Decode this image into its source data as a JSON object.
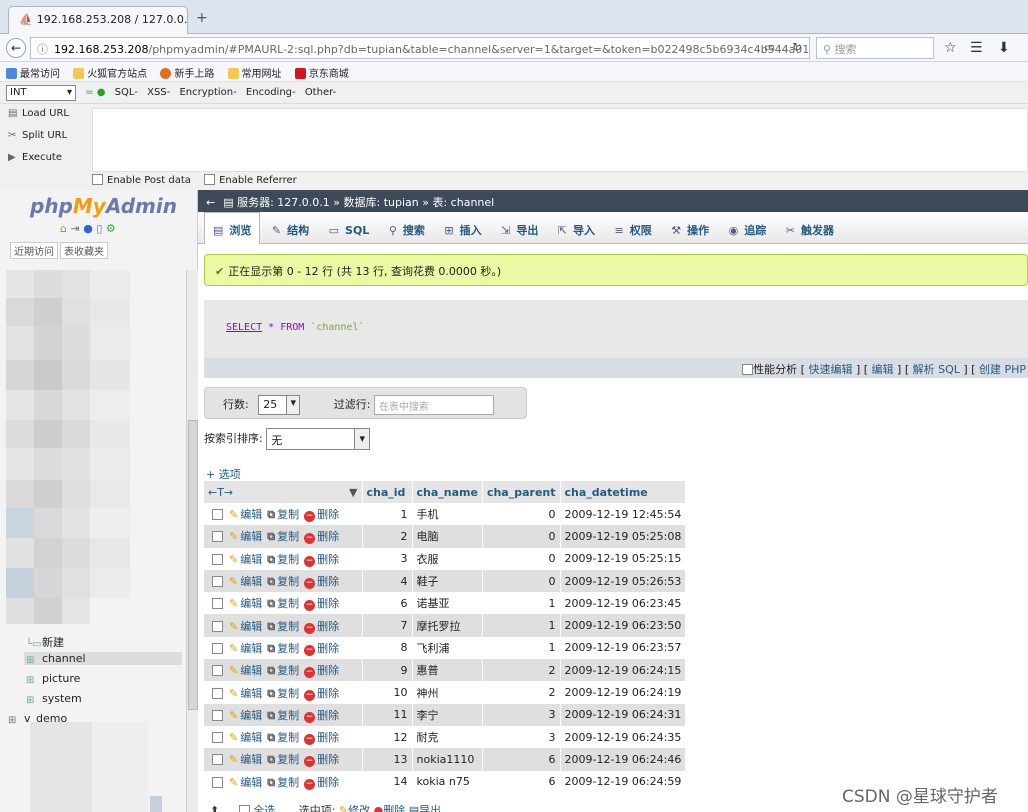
{
  "browser": {
    "tab_title": "192.168.253.208 / 127.0.0.1 ×",
    "url_host": "192.168.253.208",
    "url_rest": "/phpmyadmin/#PMAURL-2:sql.php?db=tupian&table=channel&server=1&target=&token=b022498c5b6934c4b544a012702",
    "search_placeholder": "搜索",
    "bookmarks": [
      "最常访问",
      "火狐官方站点",
      "新手上路",
      "常用网址",
      "京东商城"
    ]
  },
  "hackbar": {
    "type_select": "INT",
    "menus": [
      "SQL-",
      "XSS-",
      "Encryption-",
      "Encoding-",
      "Other-"
    ],
    "buttons": [
      "Load URL",
      "Split URL",
      "Execute"
    ],
    "options": [
      "Enable Post data",
      "Enable Referrer"
    ]
  },
  "pma": {
    "logo_php": "php",
    "logo_my": "My",
    "logo_admin": "Admin",
    "left_tabs": [
      "近期访问",
      "表收藏夹"
    ],
    "tree": {
      "new": "新建",
      "channel": "channel",
      "picture": "picture",
      "system": "system",
      "cut": "v_demo"
    },
    "breadcrumb": "服务器: 127.0.0.1 » 数据库: tupian » 表: channel",
    "tabs": [
      "浏览",
      "结构",
      "SQL",
      "搜索",
      "插入",
      "导出",
      "导入",
      "权限",
      "操作",
      "追踪",
      "触发器"
    ],
    "success": "正在显示第 0 - 12 行 (共 13 行, 查询花费 0.0000 秒。)",
    "sql": {
      "select": "SELECT",
      "star_from": "* FROM",
      "table": "`channel`"
    },
    "sql_links": {
      "profiling": "性能分析",
      "inline_edit": "快速编辑",
      "edit": "编辑",
      "explain": "解析 SQL",
      "create_php": "创建 PHP"
    },
    "rows_label": "行数:",
    "rows_value": "25",
    "filter_label": "过滤行:",
    "filter_placeholder": "在表中搜索",
    "sort_label": "按索引排序:",
    "sort_value": "无",
    "options_link": "+ 选项",
    "action_labels": {
      "edit": "编辑",
      "copy": "复制",
      "delete": "删除"
    },
    "columns": [
      "cha_id",
      "cha_name",
      "cha_parent",
      "cha_datetime"
    ],
    "rows": [
      {
        "id": "1",
        "name": "手机",
        "parent": "0",
        "dt": "2009-12-19 12:45:54"
      },
      {
        "id": "2",
        "name": "电脑",
        "parent": "0",
        "dt": "2009-12-19 05:25:08"
      },
      {
        "id": "3",
        "name": "衣服",
        "parent": "0",
        "dt": "2009-12-19 05:25:15"
      },
      {
        "id": "4",
        "name": "鞋子",
        "parent": "0",
        "dt": "2009-12-19 05:26:53"
      },
      {
        "id": "6",
        "name": "诺基亚",
        "parent": "1",
        "dt": "2009-12-19 06:23:45"
      },
      {
        "id": "7",
        "name": "摩托罗拉",
        "parent": "1",
        "dt": "2009-12-19 06:23:50"
      },
      {
        "id": "8",
        "name": "飞利浦",
        "parent": "1",
        "dt": "2009-12-19 06:23:57"
      },
      {
        "id": "9",
        "name": "惠普",
        "parent": "2",
        "dt": "2009-12-19 06:24:15"
      },
      {
        "id": "10",
        "name": "神州",
        "parent": "2",
        "dt": "2009-12-19 06:24:19"
      },
      {
        "id": "11",
        "name": "李宁",
        "parent": "3",
        "dt": "2009-12-19 06:24:31"
      },
      {
        "id": "12",
        "name": "耐克",
        "parent": "3",
        "dt": "2009-12-19 06:24:35"
      },
      {
        "id": "13",
        "name": "nokia1110",
        "parent": "6",
        "dt": "2009-12-19 06:24:46"
      },
      {
        "id": "14",
        "name": "kokia n75",
        "parent": "6",
        "dt": "2009-12-19 06:24:59"
      }
    ],
    "bottom": {
      "check_all": "全选",
      "selected": "选中项:",
      "edit": "修改",
      "delete": "删除",
      "export": "导出"
    }
  },
  "watermark": "CSDN @星球守护者"
}
